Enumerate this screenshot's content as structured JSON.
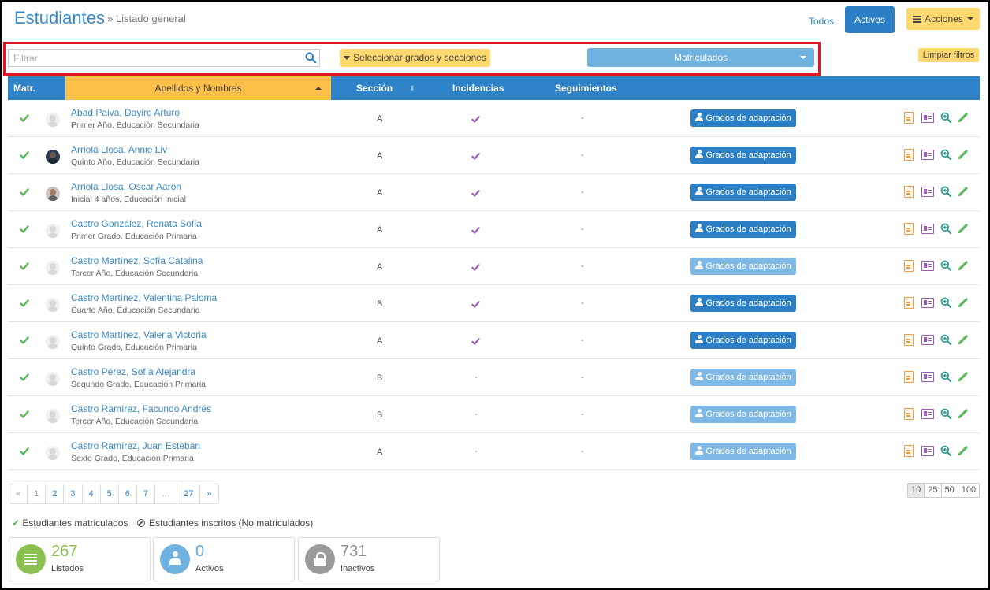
{
  "header": {
    "title": "Estudiantes",
    "breadcrumb": "» Listado general",
    "todos_label": "Todos",
    "activos_label": "Activos",
    "acciones_label": "Acciones"
  },
  "filters": {
    "search_placeholder": "Filtrar",
    "search_value": "",
    "grades_button": "Seleccionar grados y secciones",
    "status_select": "Matriculados",
    "clear_button": "Limpiar filtros"
  },
  "table": {
    "columns": {
      "matr": "Matr.",
      "name": "Apellidos y Nombres",
      "section": "Sección",
      "sort_glyph": "⬍",
      "incidents": "Incidencias",
      "followups": "Seguimientos"
    },
    "adaptation_label": "Grados de adaptación",
    "rows": [
      {
        "name": "Abad Paiva, Dayiro Arturo",
        "grade": "Primer Año, Educación Secundaria",
        "section": "A",
        "incidents": true,
        "followups": "-",
        "avatar": "default",
        "adaptation_active": true
      },
      {
        "name": "Arriola Llosa, Annie Liv",
        "grade": "Quinto Año, Educación Secundaria",
        "section": "A",
        "incidents": true,
        "followups": "-",
        "avatar": "photo1",
        "adaptation_active": true
      },
      {
        "name": "Arriola Llosa, Oscar Aaron",
        "grade": "Inicial 4 años, Educación Inicial",
        "section": "A",
        "incidents": true,
        "followups": "-",
        "avatar": "photo2",
        "adaptation_active": true
      },
      {
        "name": "Castro González, Renata Sofía",
        "grade": "Primer Grado, Educación Primaria",
        "section": "A",
        "incidents": true,
        "followups": "-",
        "avatar": "default",
        "adaptation_active": true
      },
      {
        "name": "Castro Martínez, Sofía Catalina",
        "grade": "Tercer Año, Educación Secundaria",
        "section": "A",
        "incidents": true,
        "followups": "-",
        "avatar": "default",
        "adaptation_active": false
      },
      {
        "name": "Castro Martínez, Valentina Paloma",
        "grade": "Cuarto Año, Educación Secundaria",
        "section": "B",
        "incidents": true,
        "followups": "-",
        "avatar": "default",
        "adaptation_active": true
      },
      {
        "name": "Castro Martínez, Valeria Victoria",
        "grade": "Quinto Grado, Educación Primaria",
        "section": "A",
        "incidents": true,
        "followups": "-",
        "avatar": "default",
        "adaptation_active": true
      },
      {
        "name": "Castro Pérez, Sofía Alejandra",
        "grade": "Segundo Grado, Educación Primaria",
        "section": "B",
        "incidents": false,
        "followups": "-",
        "avatar": "default",
        "adaptation_active": false
      },
      {
        "name": "Castro Ramírez, Facundo Andrés",
        "grade": "Tercer Año, Educación Secundaria",
        "section": "B",
        "incidents": false,
        "followups": "-",
        "avatar": "default",
        "adaptation_active": false
      },
      {
        "name": "Castro Ramírez, Juan Esteban",
        "grade": "Sexto Grado, Educación Primaria",
        "section": "A",
        "incidents": false,
        "followups": "-",
        "avatar": "default",
        "adaptation_active": false
      }
    ],
    "incident_none": "-"
  },
  "pagination": {
    "prev": "«",
    "pages": [
      "1",
      "2",
      "3",
      "4",
      "5",
      "6",
      "7"
    ],
    "ellipsis": "...",
    "last": "27",
    "next": "»",
    "per_page": [
      "10",
      "25",
      "50",
      "100"
    ]
  },
  "legend": {
    "enrolled": "Estudiantes matriculados",
    "registered": "Estudiantes inscritos (No matriculados)"
  },
  "stats": [
    {
      "value": "267",
      "label": "Listados"
    },
    {
      "value": "0",
      "label": "Activos"
    },
    {
      "value": "731",
      "label": "Inactivos"
    }
  ],
  "colors": {
    "primary": "#2c7fc5",
    "accent_yellow": "#ffd86e",
    "check_green": "#5cb85c",
    "incident_purple": "#9b59b6",
    "highlight_red": "#e0141e"
  }
}
